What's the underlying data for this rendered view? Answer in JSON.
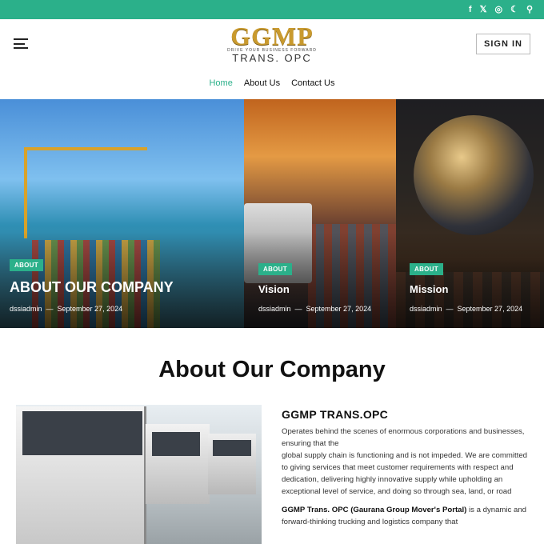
{
  "topbar": {
    "icons": [
      "facebook-icon",
      "x-icon",
      "instagram-icon",
      "moon-icon",
      "search-icon"
    ],
    "icon_glyphs": {
      "facebook": "f",
      "x": "𝕏",
      "instagram": "◎",
      "moon": "☾",
      "search": "⚲"
    },
    "color": "#2bb08a"
  },
  "header": {
    "logo_main": "GGMP",
    "logo_tagline": "DRIVE YOUR BUSINESS FORWARD",
    "logo_sub": "TRANS. OPC",
    "signin_label": "SIGN IN"
  },
  "nav": {
    "items": [
      {
        "label": "Home",
        "active": true
      },
      {
        "label": "About Us",
        "active": false
      },
      {
        "label": "Contact Us",
        "active": false
      }
    ]
  },
  "hero": {
    "cards": [
      {
        "badge": "ABOUT",
        "title": "ABOUT OUR COMPANY",
        "author": "dssiadmin",
        "date": "September 27, 2024"
      },
      {
        "badge": "ABOUT",
        "title": "Vision",
        "author": "dssiadmin",
        "date": "September 27, 2024"
      },
      {
        "badge": "ABOUT",
        "title": "Mission",
        "author": "dssiadmin",
        "date": "September 27, 2024"
      }
    ],
    "separator": "—"
  },
  "about": {
    "heading": "About Our Company",
    "subheading": "GGMP TRANS.OPC",
    "para1_line1": "Operates behind the scenes of enormous corporations and businesses, ensuring that the",
    "para1_line2": "global supply chain is functioning and is not impeded. We are committed to giving services that meet customer requirements with respect and dedication, delivering highly innovative supply while upholding an exceptional level of service, and doing so through sea, land, or road",
    "para2_bold": "GGMP Trans. OPC (Gaurana Group Mover's Portal)",
    "para2_rest": " is a dynamic and forward-thinking trucking and logistics company that"
  }
}
